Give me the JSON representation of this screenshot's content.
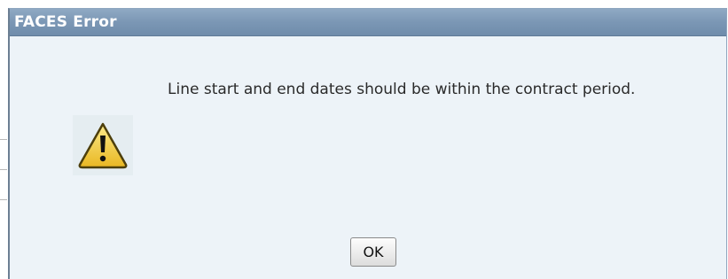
{
  "dialog": {
    "title": "FACES Error",
    "message": "Line start and end dates should be within the contract period.",
    "icon": "warning-icon",
    "ok_label": "OK"
  },
  "colors": {
    "titlebar": "#7b97b5",
    "dialog_background": "#edf3f8",
    "warning_fill": "#f2cf4a",
    "warning_stroke": "#5a4a10"
  }
}
